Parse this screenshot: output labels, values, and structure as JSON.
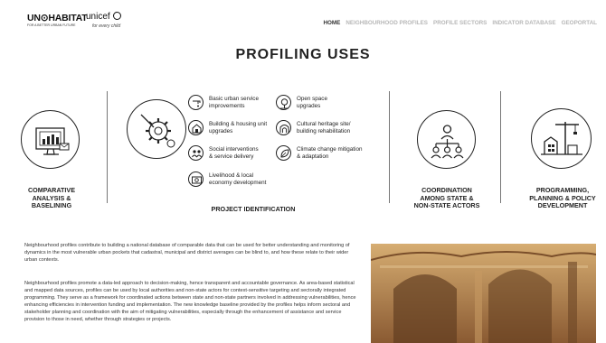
{
  "header": {
    "logo_un": "UN⊙HABITAT",
    "logo_un_tagline": "FOR A BETTER URBAN FUTURE",
    "logo_unicef": "unicef",
    "logo_unicef_tagline": "for every child",
    "nav": [
      {
        "label": "HOME",
        "active": true
      },
      {
        "label": "NEIGHBOURHOOD PROFILES",
        "active": false
      },
      {
        "label": "PROFILE SECTORS",
        "active": false
      },
      {
        "label": "INDICATOR DATABASE",
        "active": false
      },
      {
        "label": "GEOPORTAL",
        "active": false
      }
    ]
  },
  "page_title": "PROFILING USES",
  "uses": {
    "comparative": "COMPARATIVE\nANALYSIS &\nBASELINING",
    "project_identification": "PROJECT IDENTIFICATION",
    "coordination": "COORDINATION\nAMONG STATE &\nNON-STATE ACTORS",
    "programming": "PROGRAMMING,\nPLANNING & POLICY\nDEVELOPMENT"
  },
  "project_items": [
    {
      "text": "Basic urban service\nimprovements",
      "icon": "tap-icon"
    },
    {
      "text": "Building & housing unit\nupgrades",
      "icon": "house-icon"
    },
    {
      "text": "Social interventions\n& service delivery",
      "icon": "people-icon"
    },
    {
      "text": "Livelihood & local\neconomy development",
      "icon": "money-icon"
    },
    {
      "text": "Open space\nupgrades",
      "icon": "tree-icon"
    },
    {
      "text": "Cultural heritage site/\nbuilding rehabilitation",
      "icon": "arch-icon"
    },
    {
      "text": "Climate change mitigation\n& adaptation",
      "icon": "leaf-icon"
    }
  ],
  "paragraphs": [
    "Neighbourhood profiles contribute to building a national database of comparable data that can be used for better understanding and monitoring of dynamics in the most vulnerable urban pockets that cadastral, municipal and district averages can be blind to, and how these relate to their wider urban contexts.",
    "Neighbourhood profiles promote a data-led approach to decision-making, hence transparent and accountable governance. As area-based statistical and mapped data sources, profiles can be used by local authorities and non-state actors for context-sensitive targeting and sectorally integrated programming. They serve as a framework for coordinated actions between state and non-state partners involved in addressing vulnerabilities, hence enhancing efficiencies in intervention funding and implementation. The new knowledge baseline provided by the profiles helps inform sectoral and stakeholder planning and coordination with the aim of mitigating vulnerabilities, especially through the enhancement of assistance and service provision to those in need, whether through strategies or projects."
  ],
  "colors": {
    "nav_active": "#333333",
    "nav_inactive": "#b7b7b7",
    "photo_tone": "#b98a58"
  }
}
